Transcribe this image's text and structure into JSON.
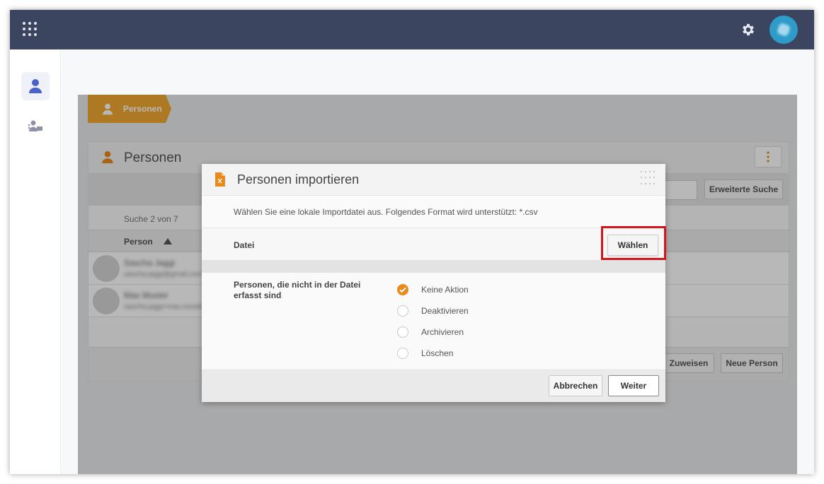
{
  "breadcrumb": {
    "label": "Personen"
  },
  "panel": {
    "title": "Personen",
    "advanced_search_label": "Erweiterte Suche",
    "result_count": "Suche 2 von 7",
    "column_person": "Person",
    "rows": [
      {
        "name": "Sascha Jaggi",
        "email": "sascha.jaggi@gmail.com"
      },
      {
        "name": "Max Muster",
        "email": "sascha.jaggi+max.muster@gmail.com"
      }
    ],
    "assign_label": "Zuweisen",
    "new_person_label": "Neue Person"
  },
  "dialog": {
    "title": "Personen importieren",
    "intro": "Wählen Sie eine lokale Importdatei aus. Folgendes Format wird unterstützt: *.csv",
    "file_label": "Datei",
    "choose_label": "Wählen",
    "options_label": "Personen, die nicht in der Datei erfasst sind",
    "options": [
      {
        "label": "Keine Aktion",
        "checked": true
      },
      {
        "label": "Deaktivieren",
        "checked": false
      },
      {
        "label": "Archivieren",
        "checked": false
      },
      {
        "label": "Löschen",
        "checked": false
      }
    ],
    "cancel_label": "Abbrechen",
    "next_label": "Weiter"
  },
  "colors": {
    "topbar": "#3b4560",
    "accent_orange": "#e8891b",
    "breadcrumb": "#f0a830",
    "highlight": "#d4151b",
    "nav_active": "#4a62c9"
  }
}
